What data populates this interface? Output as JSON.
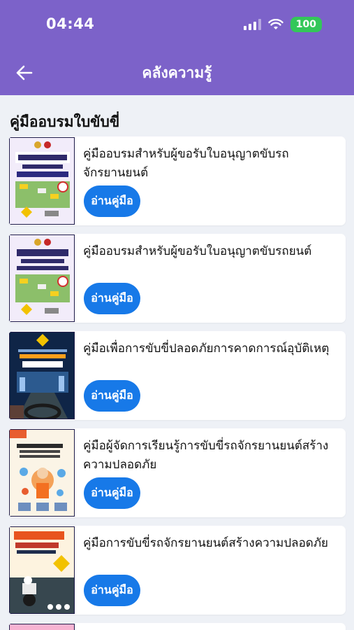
{
  "status": {
    "time": "04:44",
    "battery": "100"
  },
  "header": {
    "title": "คลังความรู้"
  },
  "section": {
    "title": "คู่มืออบรมใบขับขี่"
  },
  "read_label": "อ่านคู่มือ",
  "manuals": [
    {
      "title": "คู่มืออบรมสำหรับผู้ขอรับใบอนุญาตขับรถจักรยานยนต์",
      "cover": "training-cover-motorcycle"
    },
    {
      "title": "คู่มืออบรมสำหรับผู้ขอรับใบอนุญาตขับรถยนต์",
      "cover": "training-cover-car"
    },
    {
      "title": "คู่มือเพื่อการขับขี่ปลอดภัยการคาดการณ์อุบัติเหตุ",
      "cover": "accident-prediction-cover"
    },
    {
      "title": "คู่มือผู้จัดการเรียนรู้การขับขี่รถจักรยานยนต์สร้างความปลอดภัย",
      "cover": "learning-manager-cover"
    },
    {
      "title": "คู่มือการขับขี่รถจักรยานยนต์สร้างความปลอดภัย",
      "cover": "motorcycle-safety-cover"
    }
  ]
}
